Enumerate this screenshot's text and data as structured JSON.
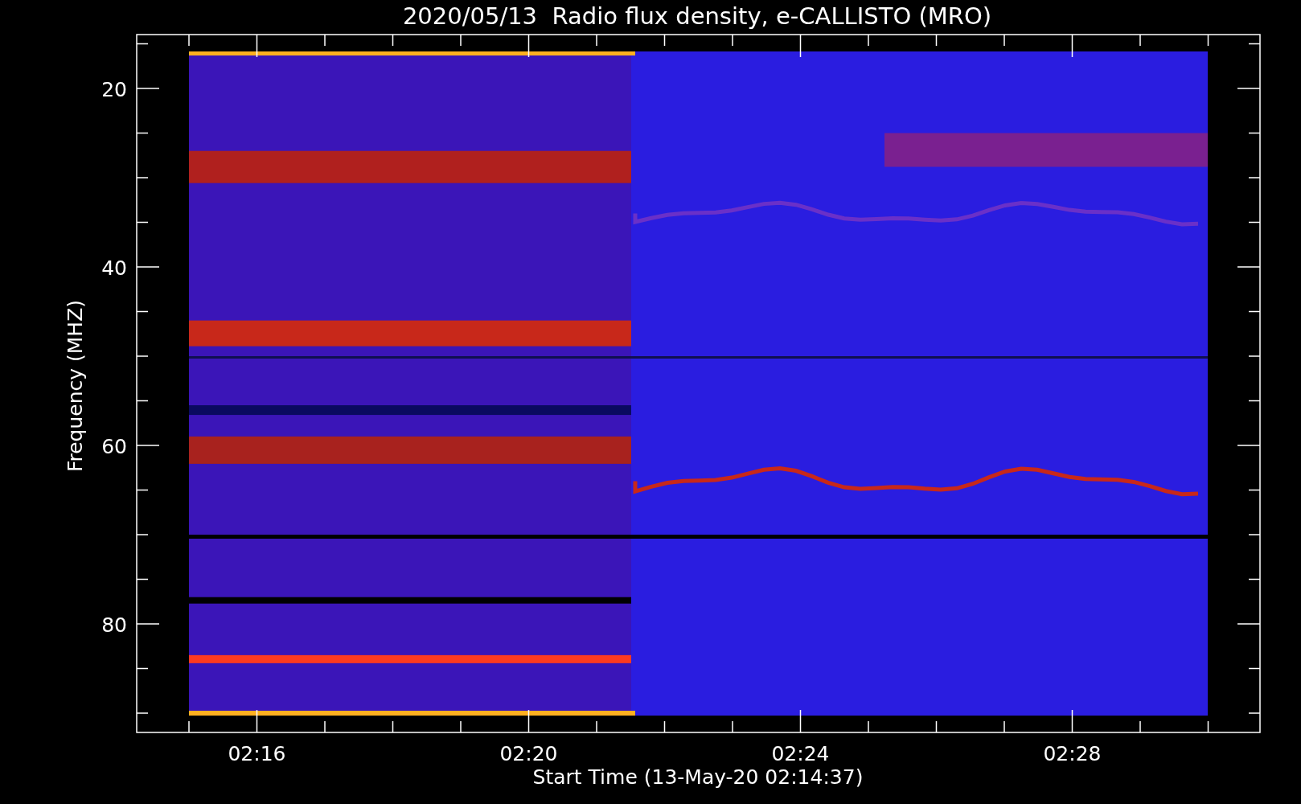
{
  "title": "2020/05/13  Radio flux density, e-CALLISTO (MRO)",
  "y_axis": {
    "label": "Frequency (MHZ)",
    "tick_labels": [
      "20",
      "40",
      "60",
      "80"
    ]
  },
  "x_axis": {
    "label": "Start Time (13-May-20 02:14:37)",
    "tick_labels": [
      "02:16",
      "02:20",
      "02:24",
      "02:28"
    ]
  }
}
